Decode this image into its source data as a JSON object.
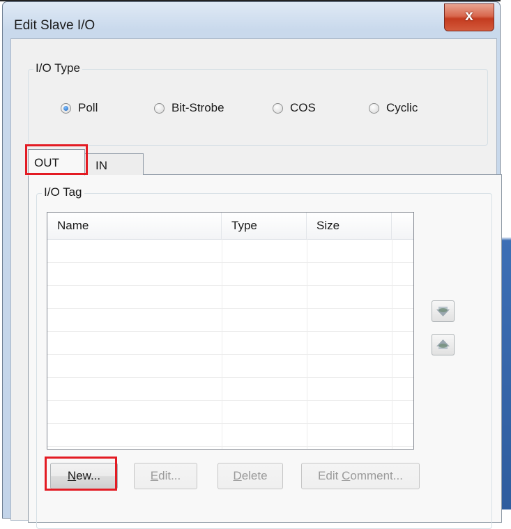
{
  "window": {
    "title": "Edit Slave I/O",
    "close_label": "x"
  },
  "io_type": {
    "legend": "I/O Type",
    "options": [
      {
        "label": "Poll",
        "selected": true
      },
      {
        "label": "Bit-Strobe",
        "selected": false
      },
      {
        "label": "COS",
        "selected": false
      },
      {
        "label": "Cyclic",
        "selected": false
      }
    ]
  },
  "tabs": [
    {
      "label": "OUT",
      "active": true
    },
    {
      "label": "IN",
      "active": false
    }
  ],
  "io_tag": {
    "legend": "I/O Tag",
    "columns": [
      "Name",
      "Type",
      "Size",
      ""
    ],
    "rows": []
  },
  "buttons": {
    "new": {
      "prefix": "N",
      "rest": "ew...",
      "enabled": true
    },
    "edit": {
      "prefix": "E",
      "rest": "dit...",
      "enabled": false
    },
    "delete": {
      "prefix": "D",
      "rest": "elete",
      "enabled": false
    },
    "edit_comment": {
      "pre": "Edit ",
      "prefix": "C",
      "rest": "omment...",
      "enabled": false
    }
  },
  "side_buttons": {
    "move_down_icon": "move-down-icon",
    "move_up_icon": "move-up-icon"
  },
  "highlight_color": "#e31b23"
}
